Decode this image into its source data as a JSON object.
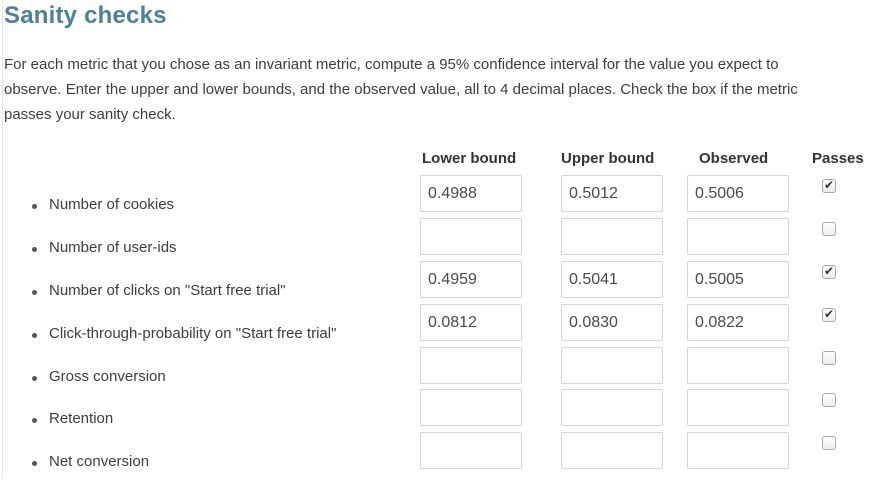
{
  "section": {
    "title": "Sanity checks",
    "description": "For each metric that you chose as an invariant metric, compute a 95% confidence interval for the value you expect to observe. Enter the upper and lower bounds, and the observed value, all to 4 decimal places. Check the box if the metric passes your sanity check."
  },
  "columns": {
    "lower": "Lower bound",
    "upper": "Upper bound",
    "observed": "Observed",
    "passes": "Passes"
  },
  "rows": [
    {
      "metric": "Number of cookies",
      "lower": "0.4988",
      "upper": "0.5012",
      "observed": "0.5006",
      "passes": true
    },
    {
      "metric": "Number of user-ids",
      "lower": "",
      "upper": "",
      "observed": "",
      "passes": false
    },
    {
      "metric": "Number of clicks on \"Start free trial\"",
      "lower": "0.4959",
      "upper": "0.5041",
      "observed": "0.5005",
      "passes": true
    },
    {
      "metric": "Click-through-probability on \"Start free trial\"",
      "lower": "0.0812",
      "upper": "0.0830",
      "observed": "0.0822",
      "passes": true
    },
    {
      "metric": "Gross conversion",
      "lower": "",
      "upper": "",
      "observed": "",
      "passes": false
    },
    {
      "metric": "Retention",
      "lower": "",
      "upper": "",
      "observed": "",
      "passes": false
    },
    {
      "metric": "Net conversion",
      "lower": "",
      "upper": "",
      "observed": "",
      "passes": false
    }
  ],
  "icons": {
    "checkmark": "check-icon"
  },
  "colors": {
    "title": "#4a7f9e",
    "input_border": "#d4d4d4"
  }
}
